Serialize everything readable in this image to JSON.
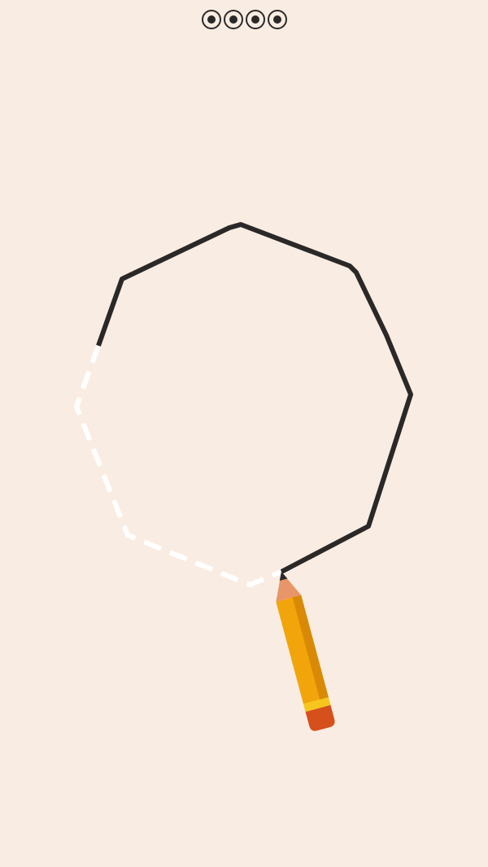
{
  "game": {
    "colors": {
      "background": "#f9ede3",
      "drawn_line": "#2b2828",
      "guide_line": "#ffffff",
      "pencil_body": "#f2a50a",
      "pencil_body_shade": "#d88a06",
      "pencil_tip_wood": "#e9956a",
      "pencil_lead": "#2b2828",
      "pencil_band": "#f7c61c",
      "pencil_eraser": "#d6501b"
    },
    "level_indicator": {
      "total_levels": 4,
      "icon": "level-dot-icon"
    },
    "shape": {
      "type": "nonagon",
      "drawn_fraction": 0.72
    }
  }
}
